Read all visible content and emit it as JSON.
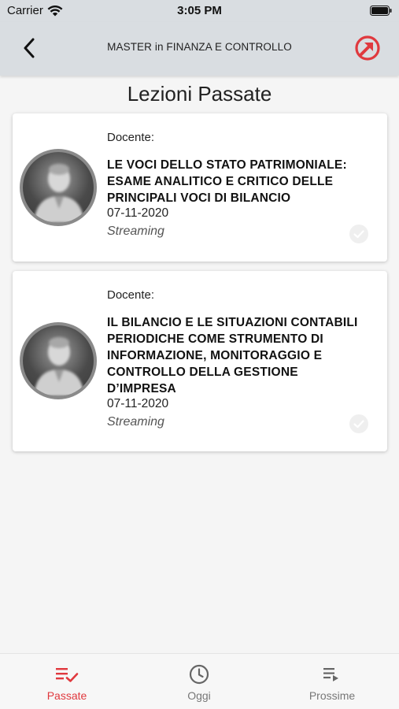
{
  "status_bar": {
    "carrier": "Carrier",
    "time": "3:05 PM"
  },
  "nav": {
    "title": "MASTER in FINANZA E CONTROLLO"
  },
  "page": {
    "heading": "Lezioni Passate"
  },
  "lessons": [
    {
      "teacher_label": "Docente:",
      "title": "LE VOCI DELLO STATO PATRIMONIALE: ESAME ANALITICO E CRITICO DELLE PRINCIPALI VOCI DI BILANCIO",
      "date": "07-11-2020",
      "mode": "Streaming"
    },
    {
      "teacher_label": "Docente:",
      "title": "IL BILANCIO E LE SITUAZIONI CONTABILI PERIODICHE COME STRUMENTO DI INFORMAZIONE, MONITORAGGIO E CONTROLLO DELLA GESTIONE D’IMPRESA",
      "date": "07-11-2020",
      "mode": "Streaming"
    }
  ],
  "tabs": [
    {
      "label": "Passate",
      "icon": "list-check-icon",
      "active": true
    },
    {
      "label": "Oggi",
      "icon": "clock-icon",
      "active": false
    },
    {
      "label": "Prossime",
      "icon": "list-play-icon",
      "active": false
    }
  ],
  "colors": {
    "accent": "#e0393e",
    "nav_bg": "#d9dde1",
    "background": "#f5f5f5"
  }
}
